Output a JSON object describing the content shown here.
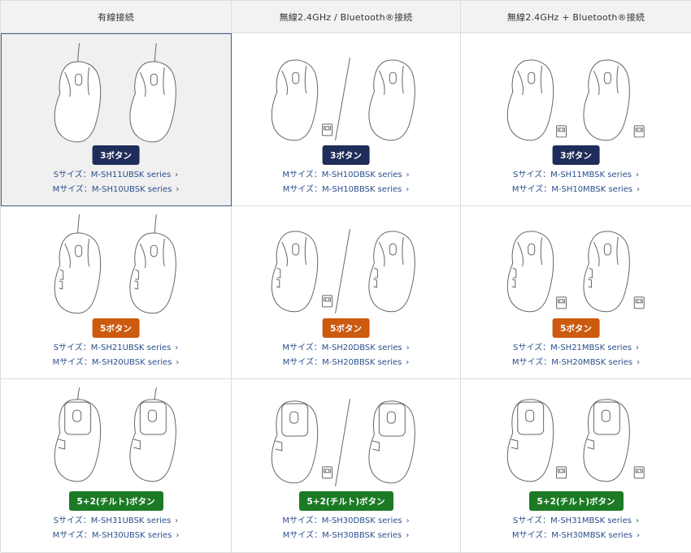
{
  "headers": [
    "有線接続",
    "無線2.4GHz / Bluetooth®接続",
    "無線2.4GHz + Bluetooth®接続"
  ],
  "rows": [
    {
      "badge": "3ボタン",
      "badge_color": "#1f2d5a",
      "cells": [
        {
          "links": [
            "Sサイズ：M-SH11UBSK series",
            "Mサイズ：M-SH10UBSK series"
          ]
        },
        {
          "links": [
            "Mサイズ：M-SH10DBSK series",
            "Mサイズ：M-SH10BBSK series"
          ]
        },
        {
          "links": [
            "Sサイズ：M-SH11MBSK series",
            "Mサイズ：M-SH10MBSK series"
          ]
        }
      ]
    },
    {
      "badge": "5ボタン",
      "badge_color": "#cc5a0f",
      "cells": [
        {
          "links": [
            "Sサイズ：M-SH21UBSK series",
            "Mサイズ：M-SH20UBSK series"
          ]
        },
        {
          "links": [
            "Mサイズ：M-SH20DBSK series",
            "Mサイズ：M-SH20BBSK series"
          ]
        },
        {
          "links": [
            "Sサイズ：M-SH21MBSK series",
            "Mサイズ：M-SH20MBSK series"
          ]
        }
      ]
    },
    {
      "badge": "5+2(チルト)ボタン",
      "badge_color": "#1c7a25",
      "cells": [
        {
          "links": [
            "Sサイズ：M-SH31UBSK series",
            "Mサイズ：M-SH30UBSK series"
          ]
        },
        {
          "links": [
            "Mサイズ：M-SH30DBSK series",
            "Mサイズ：M-SH30BBSK series"
          ]
        },
        {
          "links": [
            "Sサイズ：M-SH31MBSK series",
            "Mサイズ：M-SH30MBSK series"
          ]
        }
      ]
    }
  ],
  "icons": {
    "link_arrow": "chevron-right-icon",
    "wired": "wired-mouse-icon",
    "wireless_or": "wireless-mouse-pair-icon",
    "wireless_and": "wireless-mouse-dongle-icon"
  }
}
